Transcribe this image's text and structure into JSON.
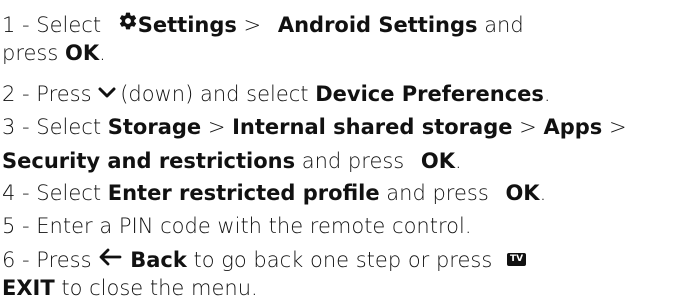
{
  "steps": [
    {
      "l1_prefix": "1 -  Select ",
      "l1_settings": "Settings",
      "l1_sep": " > ",
      "l1_android": "Android Settings",
      "l1_and": " and",
      "l2_press": "press ",
      "l2_ok": "OK",
      "l2_end": "."
    },
    {
      "prefix": "2 -  Press ",
      "down": "(down) and select ",
      "device": "Device Preferences",
      "end": "."
    },
    {
      "prefix": "3 -  Select ",
      "storage": "Storage",
      "sep1": " > ",
      "internal": "Internal shared storage",
      "sep2": " > ",
      "apps": "Apps",
      "sep3": " >",
      "security": "Security and restrictions",
      "and_press": " and press ",
      "ok": "OK",
      "end": "."
    },
    {
      "prefix": "4 -  Select ",
      "enter": "Enter restricted profile",
      "and_press": " and press ",
      "ok": "OK",
      "end": "."
    },
    {
      "text": "5 -  Enter a PIN code with the remote control."
    },
    {
      "prefix": "6 -  Press ",
      "back": "Back",
      "middle": " to go back one step or press ",
      "tv_badge": "TV",
      "exit": "EXIT",
      "end": " to close the menu."
    }
  ],
  "icons": {
    "settings": "gear-icon",
    "down": "chevron-down-icon",
    "back": "arrow-left-icon"
  }
}
